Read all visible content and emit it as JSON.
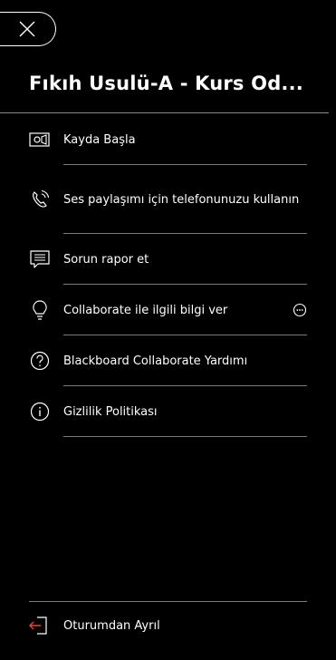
{
  "header": {
    "close_icon": "close-icon",
    "title": "Fıkıh Usulü-A - Kurs Od..."
  },
  "menu": [
    {
      "label": "Kayda Başla",
      "icon": "record-camera-icon"
    },
    {
      "label": "Ses paylaşımı için telefonunuzu kullanın",
      "icon": "phone-icon"
    },
    {
      "label": "Sorun rapor et",
      "icon": "report-issue-icon"
    },
    {
      "label": "Collaborate ile ilgili bilgi ver",
      "icon": "lightbulb-icon"
    },
    {
      "label": "Blackboard Collaborate Yardımı",
      "icon": "help-icon"
    },
    {
      "label": "Gizlilik Politikası",
      "icon": "info-icon"
    }
  ],
  "footer": {
    "leave_label": "Oturumdan Ayrıl",
    "leave_icon": "leave-session-icon"
  },
  "colors": {
    "background": "#000000",
    "text": "#ffffff",
    "divider": "#7a7a7a",
    "leave_accent": "#e8433a"
  }
}
